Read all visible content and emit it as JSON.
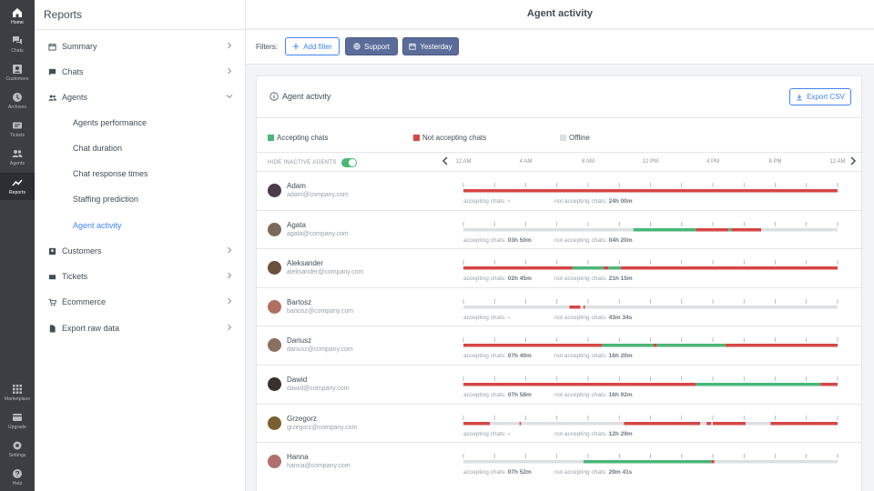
{
  "rail": [
    {
      "label": "Home",
      "icon": "home-icon",
      "active": true
    },
    {
      "label": "Chats",
      "icon": "chats-icon"
    },
    {
      "label": "Customers",
      "icon": "customers-icon"
    },
    {
      "label": "Archives",
      "icon": "archives-icon"
    },
    {
      "label": "Tickets",
      "icon": "tickets-icon"
    },
    {
      "label": "Agents",
      "icon": "agents-icon"
    },
    {
      "label": "Reports",
      "icon": "reports-icon",
      "current": true
    },
    {
      "label": "Marketplace",
      "icon": "marketplace-icon"
    },
    {
      "label": "Upgrade",
      "icon": "upgrade-icon"
    },
    {
      "label": "Settings",
      "icon": "settings-icon"
    },
    {
      "label": "Help",
      "icon": "help-icon"
    }
  ],
  "nav": {
    "title": "Reports",
    "items": [
      {
        "label": "Summary",
        "icon": "calendar-icon"
      },
      {
        "label": "Chats",
        "icon": "chat-icon"
      },
      {
        "label": "Agents",
        "icon": "agents-icon",
        "expanded": true
      },
      {
        "label": "Customers",
        "icon": "customers-icon"
      },
      {
        "label": "Tickets",
        "icon": "tickets-icon"
      },
      {
        "label": "Ecommerce",
        "icon": "cart-icon"
      },
      {
        "label": "Export raw data",
        "icon": "file-icon"
      }
    ],
    "agents_sub": [
      {
        "label": "Agents performance"
      },
      {
        "label": "Chat duration"
      },
      {
        "label": "Chat response times"
      },
      {
        "label": "Staffing prediction"
      },
      {
        "label": "Agent activity",
        "active": true
      }
    ]
  },
  "header": {
    "title": "Agent activity"
  },
  "filters": {
    "label": "Filters:",
    "add_label": "Add filter",
    "chips": [
      {
        "label": "Support",
        "icon": "globe-icon"
      },
      {
        "label": "Yesterday",
        "icon": "calendar-icon"
      }
    ]
  },
  "card": {
    "title": "Agent activity",
    "export_label": "Export CSV",
    "legend": [
      {
        "label": "Accepting chats",
        "color": "#4bb678"
      },
      {
        "label": "Not accepting chats",
        "color": "#d64646"
      },
      {
        "label": "Offline",
        "color": "#dde0e3"
      }
    ],
    "hide_inactive_label": "HIDE INACTIVE AGENTS",
    "hours": [
      "12 AM",
      "4 AM",
      "8 AM",
      "12 PM",
      "4 PM",
      "8 PM",
      "12 AM"
    ],
    "accepting_prefix": "accepting chats:",
    "not_accepting_prefix": "not accepting chats:"
  },
  "colors": {
    "accepting": "#4bb678",
    "not_accepting": "#d64646",
    "offline": "#dde0e3",
    "accent": "#4384f5"
  },
  "agents": [
    {
      "name": "Adam",
      "email": "adam@company.com",
      "accepting": "-",
      "not_accepting": "24h 00m",
      "segments": [
        [
          0,
          24,
          "r"
        ]
      ],
      "avatar_color": "#4a3a4a"
    },
    {
      "name": "Agata",
      "email": "agata@company.com",
      "accepting": "03h 50m",
      "not_accepting": "04h 20m",
      "segments": [
        [
          0,
          10.9,
          "o"
        ],
        [
          10.9,
          14.9,
          "g"
        ],
        [
          14.9,
          17.0,
          "r"
        ],
        [
          17.0,
          17.2,
          "g"
        ],
        [
          17.2,
          19.1,
          "r"
        ],
        [
          19.1,
          24,
          "o"
        ]
      ],
      "avatar_color": "#7a6a5a"
    },
    {
      "name": "Aleksander",
      "email": "aleksander@company.com",
      "accepting": "02h 45m",
      "not_accepting": "21h 15m",
      "segments": [
        [
          0,
          7.0,
          "r"
        ],
        [
          7.0,
          9.0,
          "g"
        ],
        [
          9.0,
          9.3,
          "r"
        ],
        [
          9.3,
          10.1,
          "g"
        ],
        [
          10.1,
          24,
          "r"
        ]
      ],
      "avatar_color": "#6b5040"
    },
    {
      "name": "Bartosz",
      "email": "bartosz@company.com",
      "accepting": "-",
      "not_accepting": "43m 34s",
      "segments": [
        [
          0,
          6.8,
          "o"
        ],
        [
          6.8,
          7.5,
          "r"
        ],
        [
          7.5,
          7.7,
          "o"
        ],
        [
          7.7,
          7.8,
          "r"
        ],
        [
          7.8,
          24,
          "o"
        ]
      ],
      "avatar_color": "#b07060"
    },
    {
      "name": "Dariusz",
      "email": "dariusz@company.com",
      "accepting": "07h 40m",
      "not_accepting": "16h 20m",
      "segments": [
        [
          0,
          8.9,
          "r"
        ],
        [
          8.9,
          12.2,
          "g"
        ],
        [
          12.2,
          12.4,
          "r"
        ],
        [
          12.4,
          16.8,
          "g"
        ],
        [
          16.8,
          24,
          "r"
        ]
      ],
      "avatar_color": "#8a7060"
    },
    {
      "name": "Dawid",
      "email": "dawid@company.com",
      "accepting": "07h 58m",
      "not_accepting": "16h 02m",
      "segments": [
        [
          0,
          14.9,
          "r"
        ],
        [
          14.9,
          22.9,
          "g"
        ],
        [
          22.9,
          24,
          "r"
        ]
      ],
      "avatar_color": "#3a3030"
    },
    {
      "name": "Grzegorz",
      "email": "grzegorz@company.com",
      "accepting": "-",
      "not_accepting": "12h 29m",
      "segments": [
        [
          0,
          1.7,
          "r"
        ],
        [
          1.7,
          3.6,
          "o"
        ],
        [
          3.6,
          3.7,
          "r"
        ],
        [
          3.7,
          10.3,
          "o"
        ],
        [
          10.3,
          15.2,
          "r"
        ],
        [
          15.2,
          15.6,
          "o"
        ],
        [
          15.6,
          15.9,
          "r"
        ],
        [
          15.9,
          16.0,
          "o"
        ],
        [
          16.0,
          18.1,
          "r"
        ],
        [
          18.1,
          19.7,
          "o"
        ],
        [
          19.7,
          24,
          "r"
        ]
      ],
      "avatar_color": "#7a6030"
    },
    {
      "name": "Hanna",
      "email": "hanna@company.com",
      "accepting": "07h 52m",
      "not_accepting": "29m 41s",
      "segments": [
        [
          0,
          7.7,
          "o"
        ],
        [
          7.7,
          15.9,
          "g"
        ],
        [
          15.9,
          16.1,
          "r"
        ],
        [
          16.1,
          24,
          "o"
        ]
      ],
      "avatar_color": "#b07070"
    }
  ]
}
